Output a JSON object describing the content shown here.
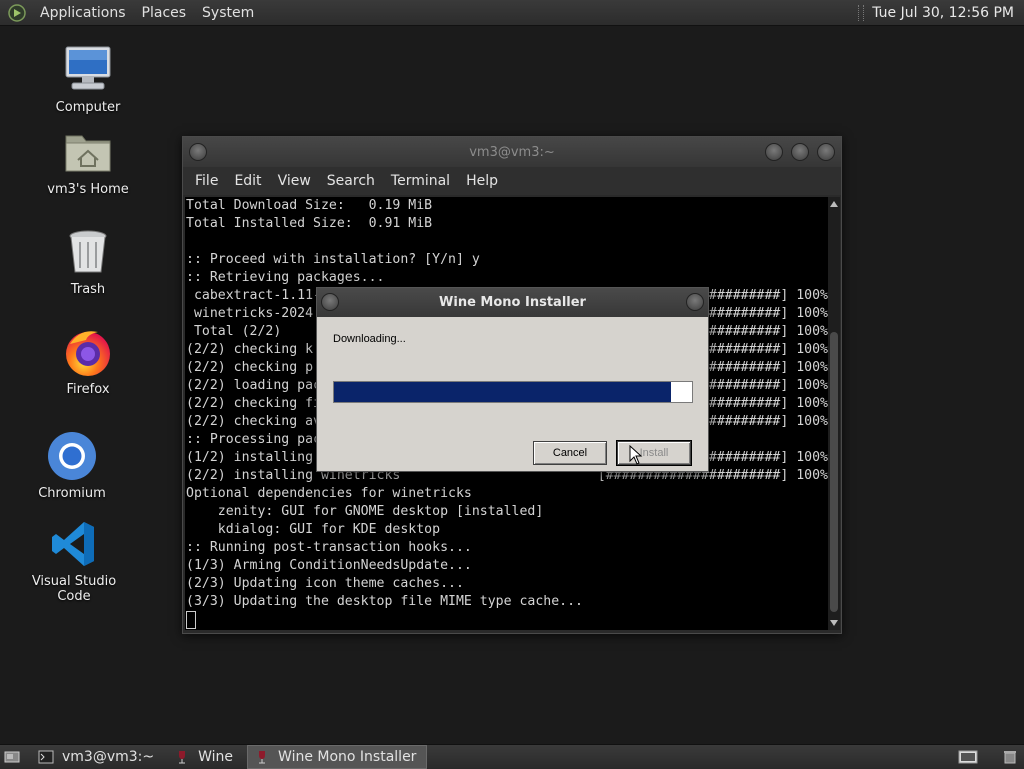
{
  "top_panel": {
    "menus": [
      "Applications",
      "Places",
      "System"
    ],
    "clock": "Tue Jul 30, 12:56 PM"
  },
  "desktop_icons": [
    {
      "label": "Computer",
      "icon": "computer-icon"
    },
    {
      "label": "vm3's Home",
      "icon": "home-folder-icon"
    },
    {
      "label": "Trash",
      "icon": "trash-icon"
    },
    {
      "label": "Firefox",
      "icon": "firefox-icon"
    },
    {
      "label": "Chromium",
      "icon": "chromium-icon"
    },
    {
      "label": "Visual Studio Code",
      "icon": "vscode-icon"
    }
  ],
  "terminal": {
    "title": "vm3@vm3:~",
    "menu": [
      "File",
      "Edit",
      "View",
      "Search",
      "Terminal",
      "Help"
    ],
    "lines": [
      {
        "left": "Total Download Size:   0.19 MiB",
        "right": ""
      },
      {
        "left": "Total Installed Size:  0.91 MiB",
        "right": ""
      },
      {
        "left": "",
        "right": ""
      },
      {
        "left": ":: Proceed with installation? [Y/n] y",
        "right": ""
      },
      {
        "left": ":: Retrieving packages...",
        "right": ""
      },
      {
        "left": " cabextract-1.11-",
        "right": "#########] 100%"
      },
      {
        "left": " winetricks-2024",
        "right": "#########] 100%"
      },
      {
        "left": " Total (2/2)",
        "right": "#########] 100%"
      },
      {
        "left": "(2/2) checking k",
        "right": "#########] 100%"
      },
      {
        "left": "(2/2) checking p",
        "right": "#########] 100%"
      },
      {
        "left": "(2/2) loading pac",
        "right": "#########] 100%"
      },
      {
        "left": "(2/2) checking fi",
        "right": "#########] 100%"
      },
      {
        "left": "(2/2) checking av",
        "right": "#########] 100%"
      },
      {
        "left": ":: Processing pac",
        "right": ""
      },
      {
        "left": "(1/2) installing",
        "right": "#########] 100%"
      },
      {
        "left": "(2/2) installing winetricks",
        "right": "[######################] 100%"
      },
      {
        "left": "Optional dependencies for winetricks",
        "right": ""
      },
      {
        "left": "    zenity: GUI for GNOME desktop [installed]",
        "right": ""
      },
      {
        "left": "    kdialog: GUI for KDE desktop",
        "right": ""
      },
      {
        "left": ":: Running post-transaction hooks...",
        "right": ""
      },
      {
        "left": "(1/3) Arming ConditionNeedsUpdate...",
        "right": ""
      },
      {
        "left": "(2/3) Updating icon theme caches...",
        "right": ""
      },
      {
        "left": "(3/3) Updating the desktop file MIME type cache...",
        "right": ""
      }
    ]
  },
  "dialog": {
    "title": "Wine Mono Installer",
    "status": "Downloading...",
    "progress": 0.94,
    "cancel_label": "Cancel",
    "install_label": "Install"
  },
  "taskbar": {
    "items": [
      {
        "label": "vm3@vm3:~",
        "icon": "terminal-icon",
        "active": false
      },
      {
        "label": "Wine",
        "icon": "wine-icon",
        "active": false
      },
      {
        "label": "Wine Mono Installer",
        "icon": "wine-icon",
        "active": true
      }
    ]
  },
  "colors": {
    "progress_fill": "#0a246a",
    "dialog_bg": "#d6d3ce",
    "terminal_bg": "#000000"
  }
}
